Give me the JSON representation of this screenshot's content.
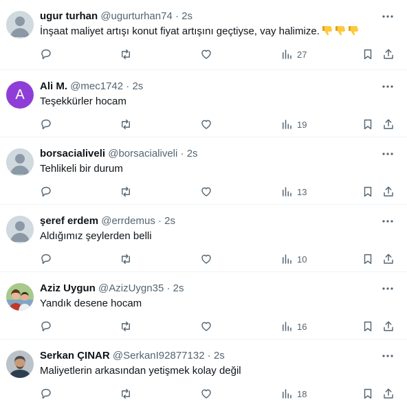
{
  "tweets": [
    {
      "name": "ugur turhan",
      "handle": "@ugurturhan74",
      "time": "2s",
      "text": "İnşaat maliyet artışı konut fiyat artışını geçtiyse, vay halimize.",
      "views": "27",
      "avatar": "default"
    },
    {
      "name": "Ali M.",
      "handle": "@mec1742",
      "time": "2s",
      "text": "Teşekkürler hocam",
      "views": "19",
      "avatar": "letter",
      "avatar_letter": "A"
    },
    {
      "name": "borsacialiveli",
      "handle": "@borsacialiveli",
      "time": "2s",
      "text": "Tehlikeli bir durum",
      "views": "13",
      "avatar": "default"
    },
    {
      "name": "şeref erdem",
      "handle": "@errdemus",
      "time": "2s",
      "text": "Aldığımız şeylerden belli",
      "views": "10",
      "avatar": "default"
    },
    {
      "name": "Aziz Uygun",
      "handle": "@AzizUygn35",
      "time": "2s",
      "text": "Yandık desene hocam",
      "views": "16",
      "avatar": "photo"
    },
    {
      "name": "Serkan ÇINAR",
      "handle": "@SerkanI92877132",
      "time": "2s",
      "text": "Maliyetlerin arkasından yetişmek kolay değil",
      "views": "18",
      "avatar": "photo"
    }
  ],
  "separator": "·",
  "icons": [
    "reply-icon",
    "retweet-icon",
    "like-icon",
    "views-icon",
    "bookmark-icon",
    "share-icon",
    "more-icon",
    "thumbs-down-emoji"
  ],
  "colors": {
    "text": "#0f1419",
    "secondary": "#536471",
    "border": "#eff3f4",
    "avatar_letter_bg": "#8e3ed6",
    "emoji": "#ffc83d"
  }
}
